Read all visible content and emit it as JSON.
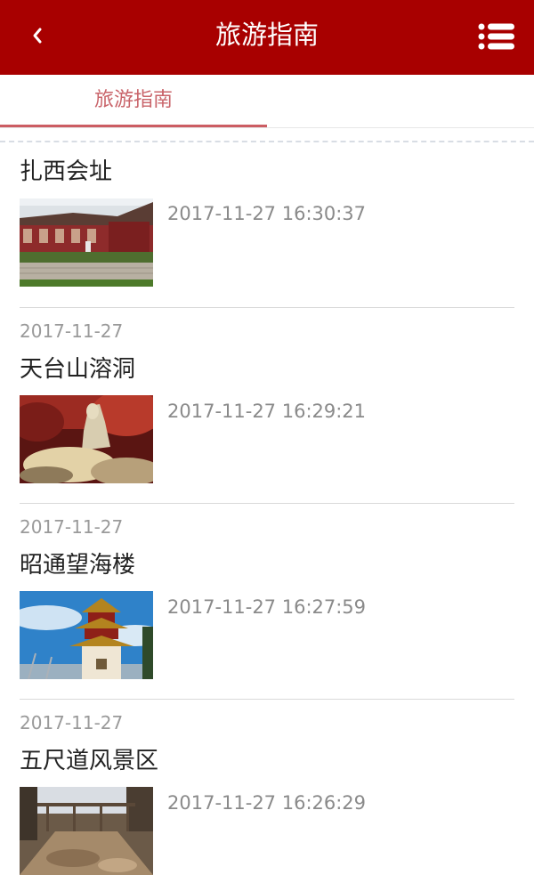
{
  "header": {
    "title": "旅游指南",
    "back_icon": "chevron-left-icon",
    "menu_icon": "list-menu-icon",
    "color": "#a80000"
  },
  "tabs": [
    {
      "label": "旅游指南",
      "active": true
    }
  ],
  "articles": [
    {
      "date": "",
      "title": "扎西会址",
      "datetime": "2017-11-27 16:30:37",
      "thumb": "historic-site-photo"
    },
    {
      "date": "2017-11-27",
      "title": "天台山溶洞",
      "datetime": "2017-11-27 16:29:21",
      "thumb": "cave-photo"
    },
    {
      "date": "2017-11-27",
      "title": "昭通望海楼",
      "datetime": "2017-11-27 16:27:59",
      "thumb": "pagoda-photo"
    },
    {
      "date": "2017-11-27",
      "title": "五尺道风景区",
      "datetime": "2017-11-27 16:26:29",
      "thumb": "scenic-path-photo"
    }
  ]
}
